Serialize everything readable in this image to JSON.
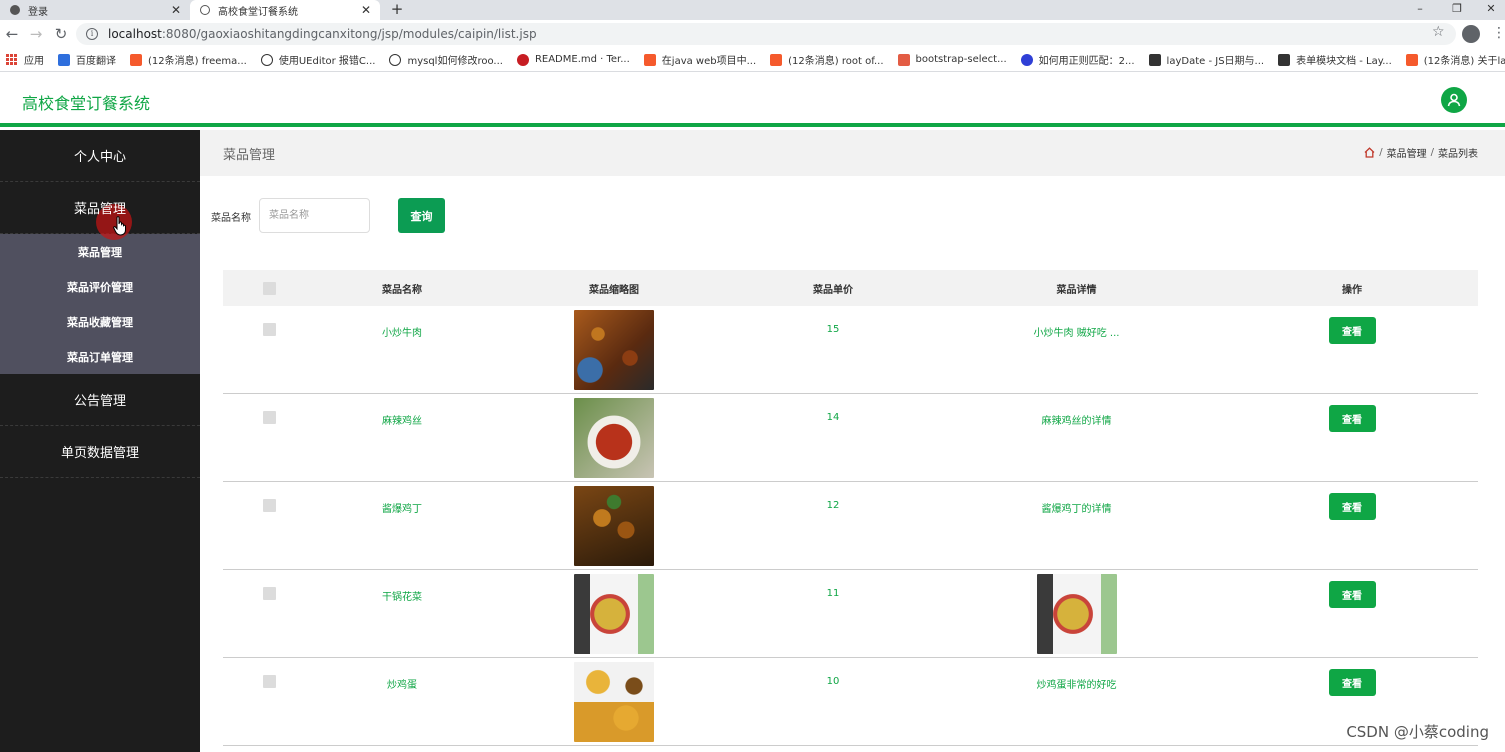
{
  "browser": {
    "tabs": [
      {
        "title": "登录",
        "close": "✕"
      },
      {
        "title": "高校食堂订餐系统",
        "close": "✕"
      }
    ],
    "new_tab": "+",
    "window_controls": [
      "–",
      "❐",
      "✕"
    ],
    "nav": {
      "back": "←",
      "forward": "→",
      "reload": "↻"
    },
    "url_host": "localhost",
    "url_path": ":8080/gaoxiaoshitangdingcanxitong/jsp/modules/caipin/list.jsp",
    "bookmarks": [
      {
        "label": "应用",
        "icon": "apps-icon",
        "color": "#db4437"
      },
      {
        "label": "百度翻译",
        "icon": "translate-icon",
        "color": "#2f6fdd"
      },
      {
        "label": "(12条消息) freema...",
        "icon": "csdn-icon",
        "color": "#f55a2c"
      },
      {
        "label": "使用UEditor 报错C...",
        "icon": "bird-icon",
        "color": "#333333"
      },
      {
        "label": "mysql如何修改roo...",
        "icon": "bird-icon",
        "color": "#333333"
      },
      {
        "label": "README.md · Ter...",
        "icon": "gitee-icon",
        "color": "#c71d23"
      },
      {
        "label": "在java web项目中...",
        "icon": "csdn-icon",
        "color": "#f55a2c"
      },
      {
        "label": "(12条消息) root of...",
        "icon": "csdn-icon",
        "color": "#f55a2c"
      },
      {
        "label": "bootstrap-select...",
        "icon": "jianshu-icon",
        "color": "#e35c44"
      },
      {
        "label": "如何用正则匹配：2...",
        "icon": "baidu-icon",
        "color": "#2f3fd6"
      },
      {
        "label": "layDate - JS日期与...",
        "icon": "layui-icon",
        "color": "#333333"
      },
      {
        "label": "表单模块文档 - Lay...",
        "icon": "layui-icon",
        "color": "#333333"
      },
      {
        "label": "(12条消息) 关于lay...",
        "icon": "csdn-icon",
        "color": "#f55a2c"
      }
    ]
  },
  "header": {
    "title": "高校食堂订餐系统",
    "accent": "#0fa645"
  },
  "sidebar": {
    "items": [
      {
        "label": "个人中心"
      },
      {
        "label": "菜品管理",
        "expanded": true,
        "children": [
          "菜品管理",
          "菜品评价管理",
          "菜品收藏管理",
          "菜品订单管理"
        ]
      },
      {
        "label": "公告管理"
      },
      {
        "label": "单页数据管理"
      }
    ]
  },
  "main": {
    "title": "菜品管理",
    "breadcrumb": [
      "菜品管理",
      "菜品列表"
    ],
    "breadcrumb_sep": "/",
    "search": {
      "label": "菜品名称",
      "placeholder": "菜品名称",
      "button": "查询"
    },
    "table": {
      "headers": [
        "菜品名称",
        "菜品缩略图",
        "菜品单价",
        "菜品详情",
        "操作"
      ],
      "action_label": "查看",
      "rows": [
        {
          "name": "小炒牛肉",
          "image": "stir-fried-beef-photo",
          "price": "15",
          "detail": "小炒牛肉 贼好吃 ..."
        },
        {
          "name": "麻辣鸡丝",
          "image": "spicy-shredded-chicken-photo",
          "price": "14",
          "detail": "麻辣鸡丝的详情"
        },
        {
          "name": "酱爆鸡丁",
          "image": "sauce-diced-chicken-photo",
          "price": "12",
          "detail": "酱爆鸡丁的详情"
        },
        {
          "name": "干锅花菜",
          "image": "dry-pot-cauliflower-photo",
          "price": "11",
          "detail": "",
          "detail_image": "dry-pot-cauliflower-photo"
        },
        {
          "name": "炒鸡蛋",
          "image": "scrambled-egg-photo",
          "price": "10",
          "detail": "炒鸡蛋非常的好吃"
        }
      ]
    }
  },
  "watermark": "CSDN @小蔡coding"
}
